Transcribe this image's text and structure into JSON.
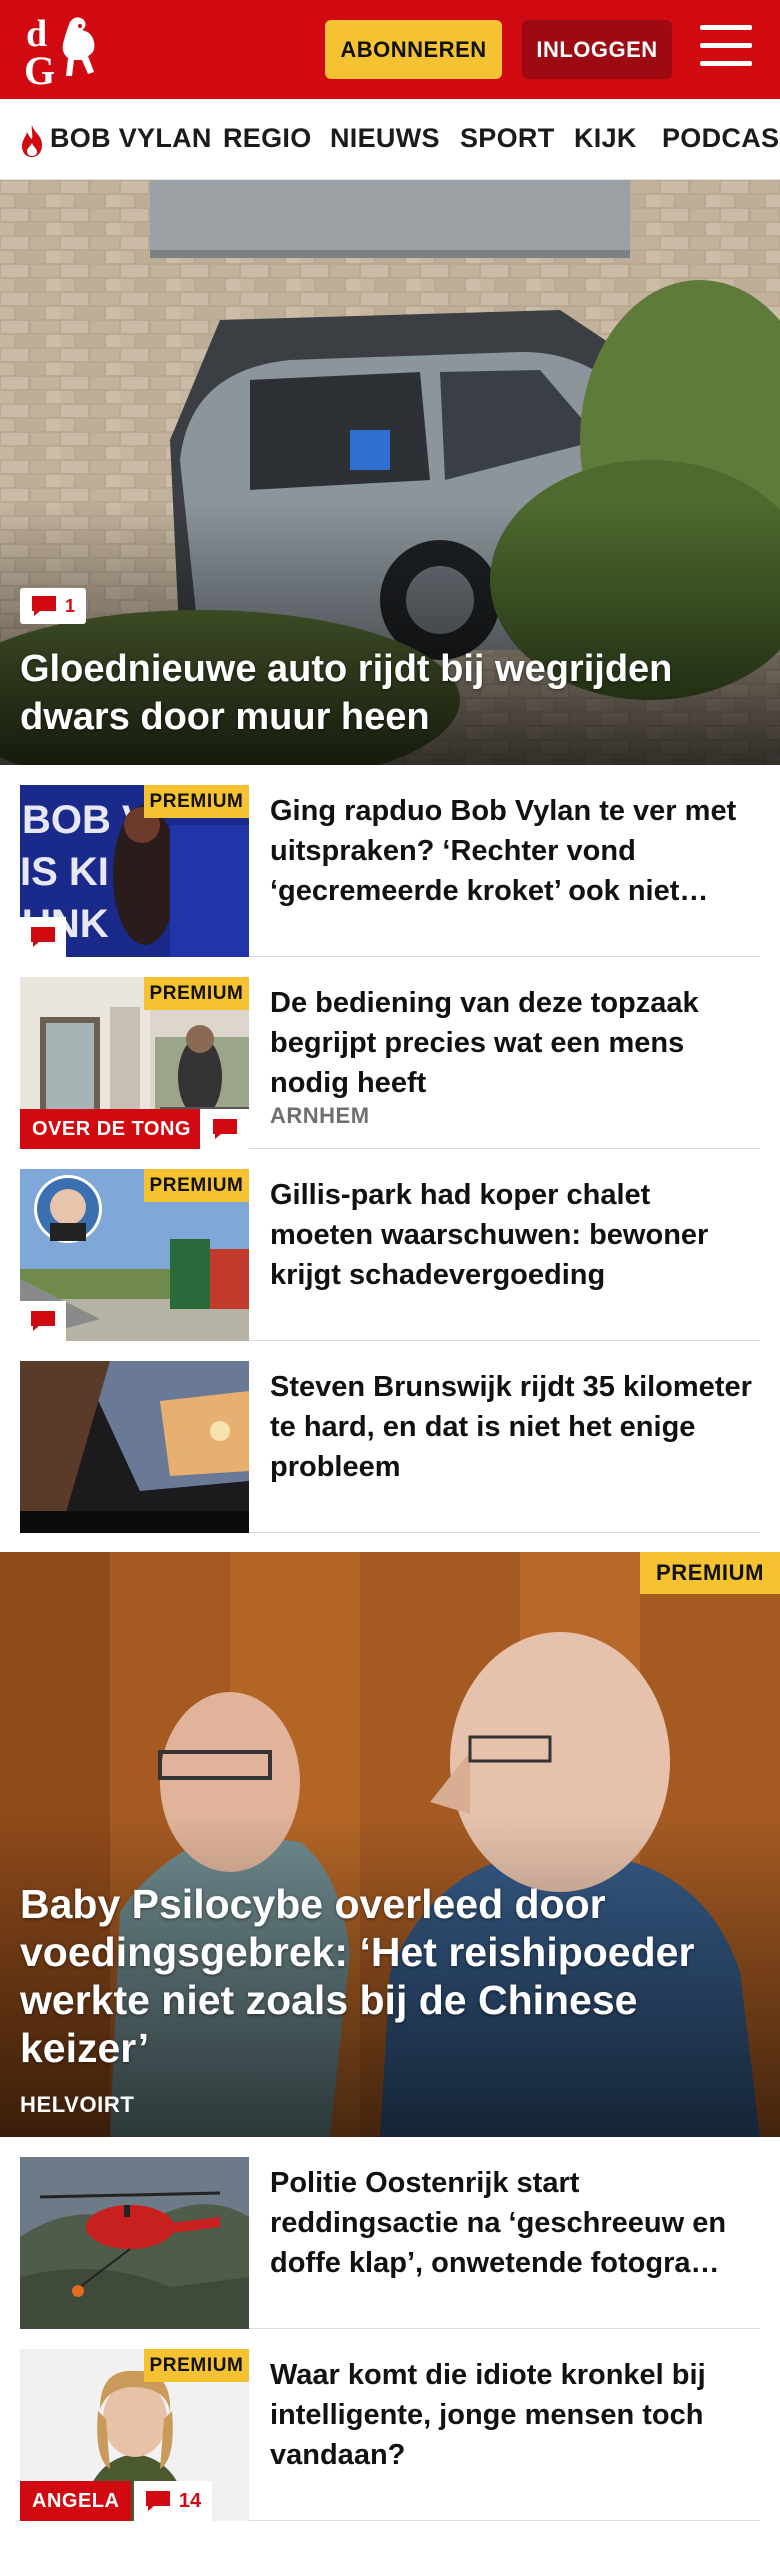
{
  "header": {
    "logo_text": "dG",
    "subscribe_label": "ABONNEREN",
    "login_label": "INLOGGEN",
    "brand_color": "#d10a11",
    "accent_color": "#f5c332"
  },
  "nav": {
    "items": [
      "BOB VYLAN",
      "REGIO",
      "NIEUWS",
      "SPORT",
      "KIJK",
      "PODCAS"
    ]
  },
  "hero": {
    "comment_count": "1",
    "title": "Gloednieuwe auto rijdt bij wegrijden dwars door muur heen"
  },
  "articles": [
    {
      "premium": "PREMIUM",
      "title": "Ging rapduo Bob Vylan te ver met uitspraken? ‘Rechter vond ‘gecremeerde kroket’ ook niet…",
      "comment_icon": "comment-icon"
    },
    {
      "premium": "PREMIUM",
      "tag": "OVER DE TONG",
      "title": "De bediening van deze topzaak begrijpt precies wat een mens nodig heeft",
      "meta": "ARNHEM",
      "comment_icon": "comment-icon"
    },
    {
      "premium": "PREMIUM",
      "title": "Gillis-park had koper chalet moeten waarschuwen: bewoner krijgt schadevergoeding",
      "comment_icon": "comment-icon"
    },
    {
      "title": "Steven Brunswijk rijdt 35 kilometer te hard, en dat is niet het enige probleem"
    }
  ],
  "big_story": {
    "premium": "PREMIUM",
    "title": "Baby Psilocybe overleed door voedingsgebrek: ‘Het reishipoeder werkte niet zoals bij de Chinese keizer’",
    "location": "HELVOIRT"
  },
  "articles2": [
    {
      "title": "Politie Oostenrijk start reddingsactie na ‘geschreeuw en doffe klap’, onwetende fotogra…"
    },
    {
      "premium": "PREMIUM",
      "tag": "ANGELA",
      "comment_count": "14",
      "title": "Waar komt die idiote kronkel bij intelligente, jonge mensen toch vandaan?"
    }
  ]
}
